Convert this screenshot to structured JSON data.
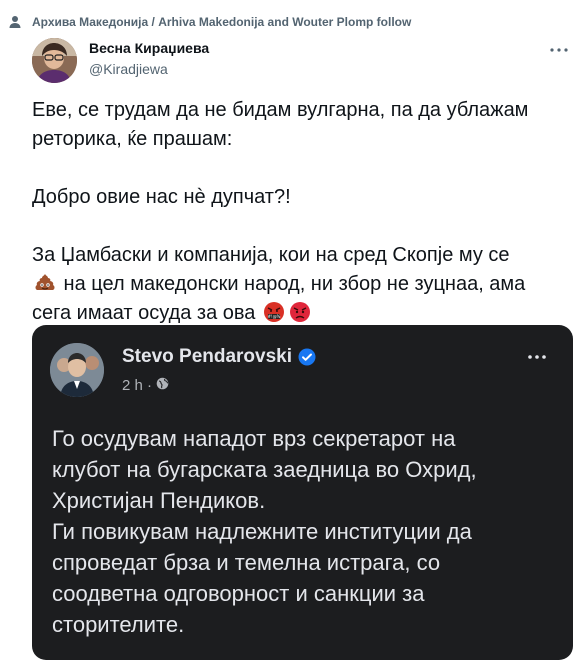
{
  "social_context": {
    "text": "Архива Македонија / Arhiva Makedonija and Wouter Plomp follow",
    "icon": "person-icon"
  },
  "author": {
    "name": "Весна Кираџиева",
    "handle": "@Kiradjiewa"
  },
  "tweet": {
    "line1": "Еве, се трудам да не бидам вулгарна, па да ублажам",
    "line2": "реторика, ќе прашам:",
    "line3": "Добро овие нас нè дупчат?!",
    "line4": "За Џамбаски и компанија, кои на сред Скопје му се",
    "line5_after_emoji": " на цел македонски народ, ни збор не зуцнаа, ама",
    "line6": "сега имаат осуда за ова ",
    "emojis": [
      "pile-of-poo-icon",
      "cursing-face-icon",
      "angry-face-icon"
    ]
  },
  "embed": {
    "name": "Stevo Pendarovski",
    "verified_icon": "verified-badge-icon",
    "time": "2 h ·",
    "privacy_icon": "globe-icon",
    "lines": [
      "Го осудувам нападот врз секретарот на",
      "клубот на бугарската заедница во Охрид,",
      "Христијан Пендиков.",
      "Ги повикувам надлежните институции да",
      "спроведат брза и темелна истрага, со",
      "соодветна одговорност и санкции за",
      "сторителите."
    ]
  },
  "colors": {
    "text_primary": "#0f1419",
    "text_secondary": "#536471",
    "card_bg": "#1c1d1f",
    "card_text": "#e4e6eb",
    "verified_blue": "#1877f2"
  }
}
